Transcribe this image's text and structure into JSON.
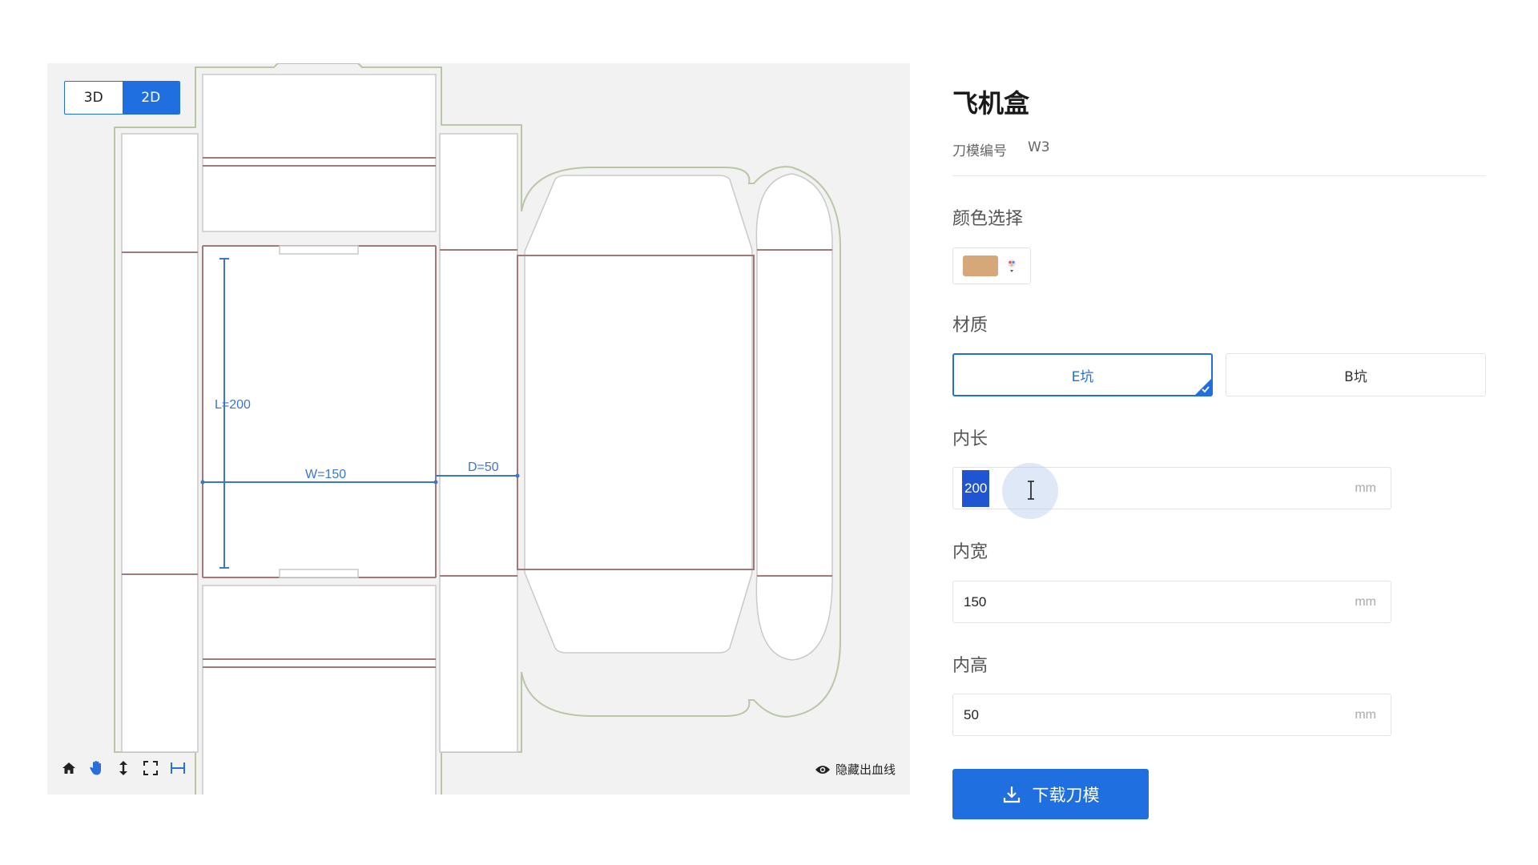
{
  "viewer": {
    "modes": [
      "3D",
      "2D"
    ],
    "active_mode": "2D",
    "dimensions": {
      "length_label": "L=200",
      "width_label": "W=150",
      "depth_label": "D=50"
    },
    "tools": [
      "home-icon",
      "hand-icon",
      "vertical-arrows-icon",
      "fullscreen-icon",
      "measure-icon"
    ],
    "bleed_toggle_label": "隐藏出血线",
    "colors": {
      "cut_line": "#a07a7a",
      "bleed_line": "#b9c7a6",
      "dimension_line": "#3a77c9",
      "canvas_bg": "#f2f2f2"
    }
  },
  "product": {
    "title": "飞机盒",
    "die_code_label": "刀模编号",
    "die_code_value": "W3"
  },
  "color_section": {
    "label": "颜色选择",
    "selected_color": "#d6a879"
  },
  "material_section": {
    "label": "材质",
    "options": [
      "E坑",
      "B坑"
    ],
    "selected": "E坑"
  },
  "inner_length": {
    "label": "内长",
    "value": "200",
    "unit": "mm"
  },
  "inner_width": {
    "label": "内宽",
    "value": "150",
    "unit": "mm"
  },
  "inner_height": {
    "label": "内高",
    "value": "50",
    "unit": "mm"
  },
  "download_button": {
    "label": "下载刀模"
  },
  "accent_color": "#1f6fe0"
}
